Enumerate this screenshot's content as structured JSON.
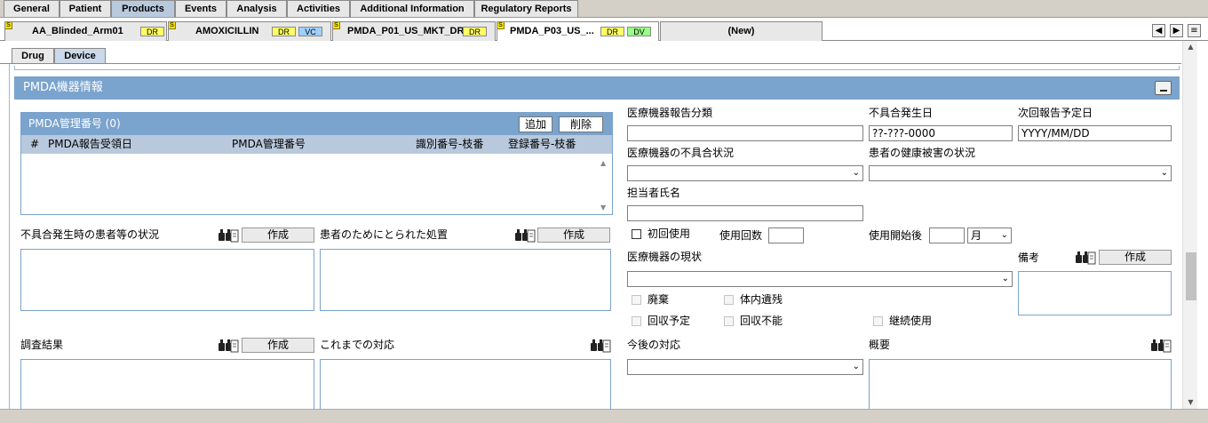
{
  "top_tabs": [
    "General",
    "Patient",
    "Products",
    "Events",
    "Analysis",
    "Activities",
    "Additional Information",
    "Regulatory Reports"
  ],
  "active_top_tab": "Products",
  "product_tabs": [
    {
      "name": "AA_Blinded_Arm01",
      "badges": [
        "DR"
      ]
    },
    {
      "name": "AMOXICILLIN",
      "badges": [
        "DR",
        "VC"
      ]
    },
    {
      "name": "PMDA_P01_US_MKT_DR",
      "badges": [
        "DR"
      ]
    },
    {
      "name": "PMDA_P03_US_...",
      "badges": [
        "DR",
        "DV"
      ]
    },
    {
      "name": "(New)",
      "badges": []
    }
  ],
  "sub_tabs": [
    "Drug",
    "Device"
  ],
  "active_sub_tab": "Device",
  "section_title": "PMDA機器情報",
  "grid": {
    "title": "PMDA管理番号 (0)",
    "add_label": "追加",
    "delete_label": "削除",
    "columns": [
      "#",
      "PMDA報告受領日",
      "PMDA管理番号",
      "識別番号-枝番",
      "登録番号-枝番"
    ]
  },
  "left": {
    "patient_status_label": "不具合発生時の患者等の状況",
    "treatment_label": "患者のためにとられた処置",
    "investigation_label": "調査結果",
    "response_so_far_label": "これまでの対応",
    "create_label": "作成"
  },
  "right": {
    "report_category_label": "医療機器報告分類",
    "malfunction_date_label": "不具合発生日",
    "malfunction_date_value": "??-???-0000",
    "next_report_label": "次回報告予定日",
    "next_report_placeholder": "YYYY/MM/DD",
    "device_malfunction_label": "医療機器の不具合状況",
    "health_damage_label": "患者の健康被害の状況",
    "person_in_charge_label": "担当者氏名",
    "first_use_label": "初回使用",
    "use_count_label": "使用回数",
    "after_use_start_label": "使用開始後",
    "month_value": "月",
    "device_status_label": "医療機器の現状",
    "remarks_label": "備考",
    "create_label": "作成",
    "disposal_label": "廃棄",
    "remaining_in_body_label": "体内遺残",
    "planned_recovery_label": "回収予定",
    "unrecoverable_label": "回収不能",
    "continued_use_label": "継続使用",
    "future_response_label": "今後の対応",
    "summary_label": "概要"
  }
}
